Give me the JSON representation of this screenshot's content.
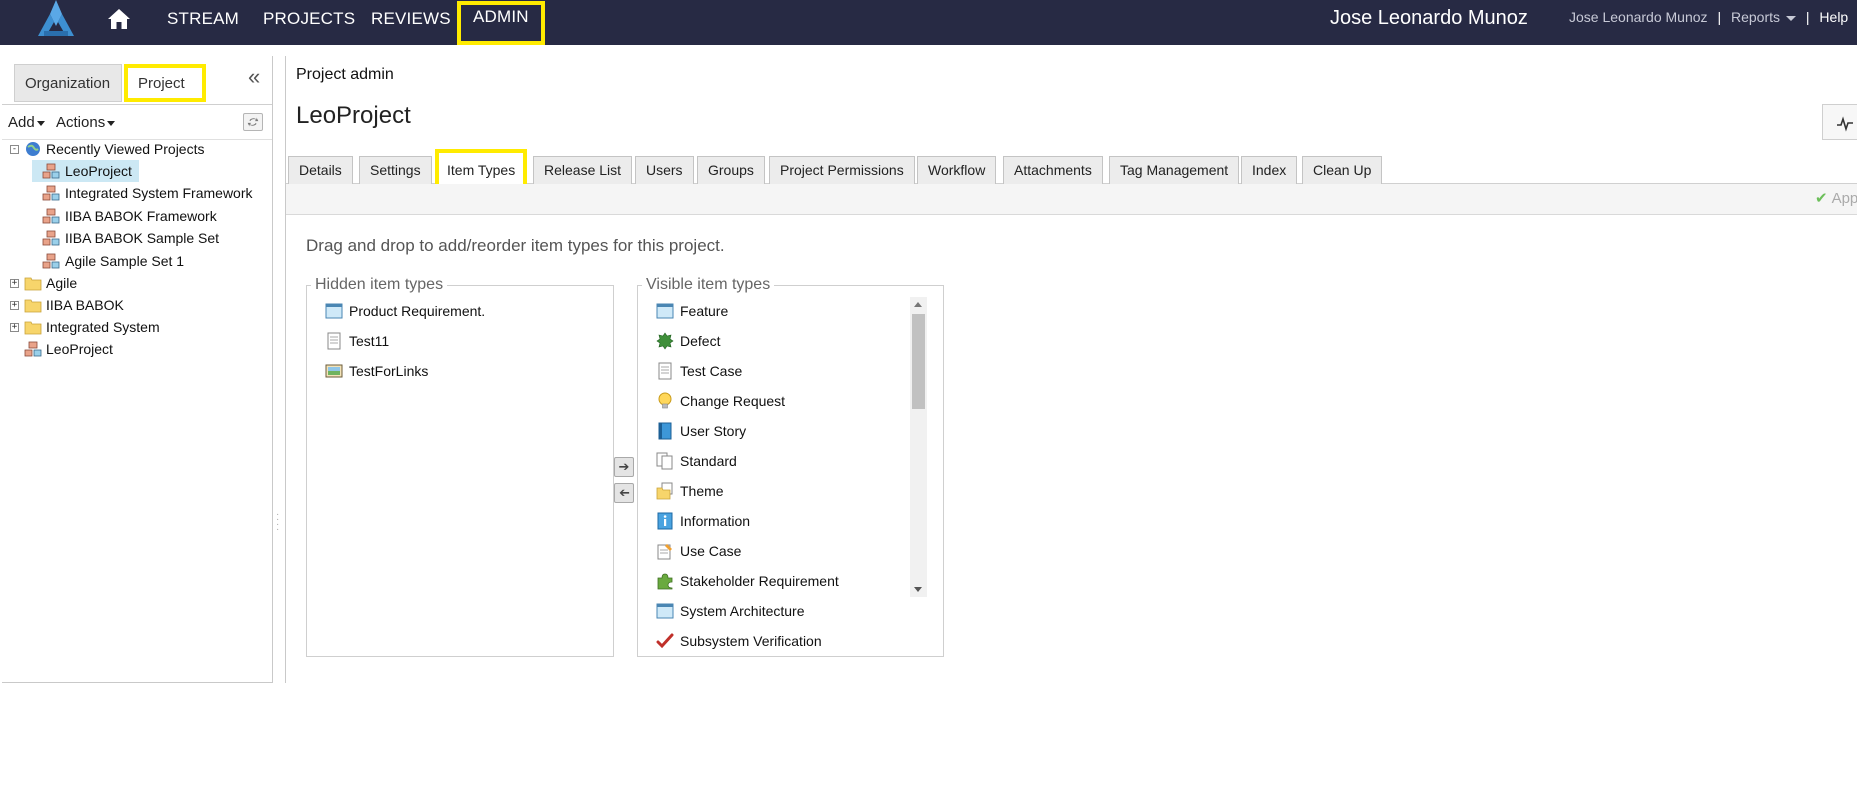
{
  "nav": {
    "links": [
      "STREAM",
      "PROJECTS",
      "REVIEWS",
      "ADMIN"
    ],
    "user_display": "Jose Leonardo Munoz",
    "user_link": "Jose Leonardo Munoz",
    "reports": "Reports",
    "help": "Help",
    "sep": "|"
  },
  "left": {
    "tabs": [
      "Organization",
      "Project"
    ],
    "add": "Add",
    "actions": "Actions",
    "tree": {
      "recent": "Recently Viewed Projects",
      "recent_items": [
        "LeoProject",
        "Integrated System Framework",
        "IIBA BABOK Framework",
        "IIBA BABOK Sample Set",
        "Agile Sample Set 1"
      ],
      "folders": [
        "Agile",
        "IIBA BABOK",
        "Integrated System"
      ],
      "root_project": "LeoProject"
    }
  },
  "main": {
    "breadcrumb": "Project admin",
    "project_title": "LeoProject",
    "tabs": [
      "Details",
      "Settings",
      "Item Types",
      "Release List",
      "Users",
      "Groups",
      "Project Permissions",
      "Workflow",
      "Attachments",
      "Tag Management",
      "Index",
      "Clean Up"
    ],
    "active_tab": "Item Types",
    "apply_label": "App",
    "instructions": "Drag and drop to add/reorder item types for this project.",
    "hidden_legend": "Hidden item types",
    "visible_legend": "Visible item types",
    "hidden_items": [
      {
        "label": "Product Requirement.",
        "icon": "window-icon"
      },
      {
        "label": "Test11",
        "icon": "document-icon"
      },
      {
        "label": "TestForLinks",
        "icon": "picture-icon"
      }
    ],
    "visible_items": [
      {
        "label": "Feature",
        "icon": "window-icon"
      },
      {
        "label": "Defect",
        "icon": "bug-icon"
      },
      {
        "label": "Test Case",
        "icon": "document-icon"
      },
      {
        "label": "Change Request",
        "icon": "lightbulb-icon"
      },
      {
        "label": "User Story",
        "icon": "book-icon"
      },
      {
        "label": "Standard",
        "icon": "pages-icon"
      },
      {
        "label": "Theme",
        "icon": "folder-doc-icon"
      },
      {
        "label": "Information",
        "icon": "info-icon"
      },
      {
        "label": "Use Case",
        "icon": "clipboard-icon"
      },
      {
        "label": "Stakeholder Requirement",
        "icon": "puzzle-icon"
      },
      {
        "label": "System Architecture",
        "icon": "window-icon"
      },
      {
        "label": "Subsystem Verification",
        "icon": "checkmark-icon"
      }
    ]
  }
}
